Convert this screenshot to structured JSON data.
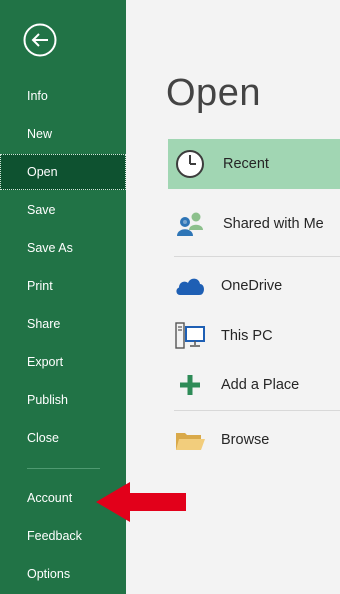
{
  "nav": {
    "back_icon": "back-arrow-circle-icon",
    "items": [
      {
        "label": "Info"
      },
      {
        "label": "New"
      },
      {
        "label": "Open"
      },
      {
        "label": "Save"
      },
      {
        "label": "Save As"
      },
      {
        "label": "Print"
      },
      {
        "label": "Share"
      },
      {
        "label": "Export"
      },
      {
        "label": "Publish"
      },
      {
        "label": "Close"
      },
      {
        "label": "Account"
      },
      {
        "label": "Feedback"
      },
      {
        "label": "Options"
      }
    ],
    "selected": "Open"
  },
  "main": {
    "title": "Open",
    "locations": [
      {
        "label": "Recent",
        "icon": "clock-icon"
      },
      {
        "label": "Shared with Me",
        "icon": "people-icon"
      },
      {
        "label": "OneDrive",
        "icon": "cloud-icon"
      },
      {
        "label": "This PC",
        "icon": "computer-icon"
      },
      {
        "label": "Add a Place",
        "icon": "plus-icon"
      },
      {
        "label": "Browse",
        "icon": "folder-icon"
      }
    ],
    "selected": "Recent"
  },
  "annotation": {
    "icon": "red-arrow-icon",
    "points_to": "Account"
  },
  "colors": {
    "nav_green": "#217346",
    "nav_selected": "#0e5230",
    "recent_selected": "#a1d6b3",
    "annotation_red": "#e2001a"
  }
}
